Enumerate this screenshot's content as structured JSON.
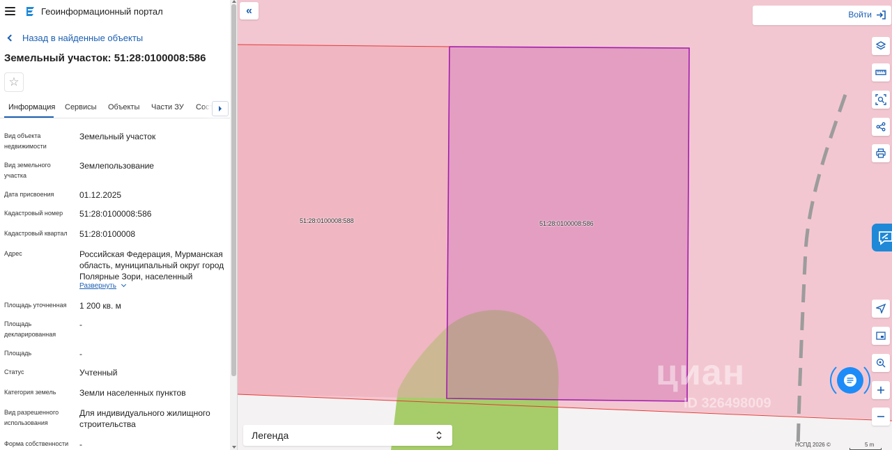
{
  "sidebar": {
    "portal_title": "Геоинформационный портал",
    "back_link": "Назад в найденные объекты",
    "object_title": "Земельный участок: 51:28:0100008:586",
    "tabs": [
      {
        "label": "Информация"
      },
      {
        "label": "Сервисы"
      },
      {
        "label": "Объекты"
      },
      {
        "label": "Части ЗУ"
      },
      {
        "label": "Состав"
      }
    ],
    "properties": [
      {
        "label": "Вид объекта недвижимости",
        "value": "Земельный участок"
      },
      {
        "label": "Вид земельного участка",
        "value": "Землепользование"
      },
      {
        "label": "Дата присвоения",
        "value": "01.12.2025"
      },
      {
        "label": "Кадастровый номер",
        "value": "51:28:0100008:586"
      },
      {
        "label": "Кадастровый квартал",
        "value": "51:28:0100008"
      },
      {
        "label": "Адрес",
        "value": "Российская Федерация, Мурманская область, муниципальный округ город Полярные Зори, населенный"
      },
      {
        "label": "Площадь уточненная",
        "value": "1 200 кв. м"
      },
      {
        "label": "Площадь декларированная",
        "value": "-"
      },
      {
        "label": "Площадь",
        "value": "-"
      },
      {
        "label": "Статус",
        "value": "Учтенный"
      },
      {
        "label": "Категория земель",
        "value": "Земли населенных пунктов"
      },
      {
        "label": "Вид разрешенного использования",
        "value": "Для индивидуального жилищного строительства"
      },
      {
        "label": "Форма собственности",
        "value": "-"
      }
    ],
    "expand_label": "Развернуть"
  },
  "map": {
    "login_label": "Войти",
    "legend_label": "Легенда",
    "parcels": [
      {
        "label": "51:28:0100008:588"
      },
      {
        "label": "51:28:0100008:586"
      }
    ],
    "watermark": "циан",
    "watermark_id": "ID 326498009",
    "attribution": "НСПД 2026 ©",
    "scale_label": "5 m",
    "tools": [
      {
        "icon": "layers-icon"
      },
      {
        "icon": "ruler-icon"
      },
      {
        "icon": "area-select-icon"
      },
      {
        "icon": "share-icon"
      },
      {
        "icon": "print-icon"
      },
      {
        "icon": "locate-icon"
      },
      {
        "icon": "minimap-icon"
      },
      {
        "icon": "geo-search-icon"
      },
      {
        "icon": "zoom-in-icon"
      },
      {
        "icon": "zoom-out-icon"
      }
    ]
  },
  "colors": {
    "accent": "#1a5fb4",
    "map_background": "#f3c7d1",
    "selected_parcel_fill": "#e09cc0",
    "selected_parcel_border": "#a21caf",
    "boundary_red": "#e53935",
    "green_zone": "#a6cd6a",
    "chat_button": "#1d8cf8"
  }
}
